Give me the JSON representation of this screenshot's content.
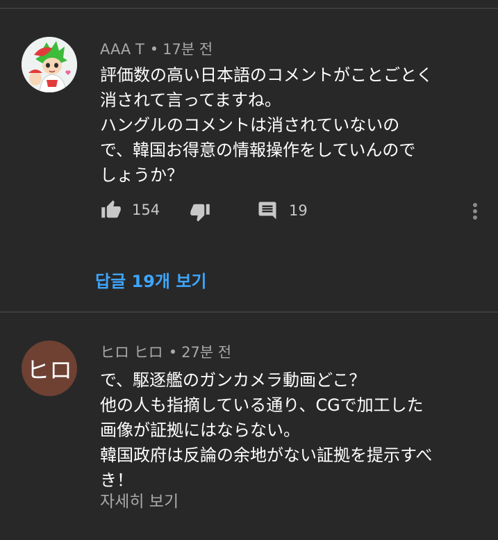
{
  "comments": [
    {
      "author": "AAA T",
      "separator": "•",
      "time": "17분 전",
      "lines": [
        "評価数の高い日本語のコメントがことごとく",
        "消されて言ってますね。",
        "ハングルのコメントは消されていないの",
        "で、韓国お得意の情報操作をしていんので",
        "しょうか？"
      ],
      "likes": "154",
      "replies": "19",
      "view_replies_label": "답글 19개 보기",
      "avatar_icon": "anime-character-avatar"
    },
    {
      "author": "ヒロ ヒロ",
      "separator": "•",
      "time": "27분 전",
      "avatar_text": "ヒロ",
      "avatar_color": "#6e4133",
      "lines": [
        "で、駆逐艦のガンカメラ動画どこ？",
        "他の人も指摘している通り、CGで加工した",
        "画像が証拠にはならない。",
        "韓国政府は反論の余地がない証拠を提示すべ",
        "き！"
      ],
      "read_more_label": "자세히 보기"
    }
  ],
  "colors": {
    "background": "#282828",
    "link": "#3ea6ff",
    "meta": "#a9a9a9"
  },
  "icons": [
    "thumbs-up-icon",
    "thumbs-down-icon",
    "reply-comment-icon",
    "more-vert-icon"
  ]
}
